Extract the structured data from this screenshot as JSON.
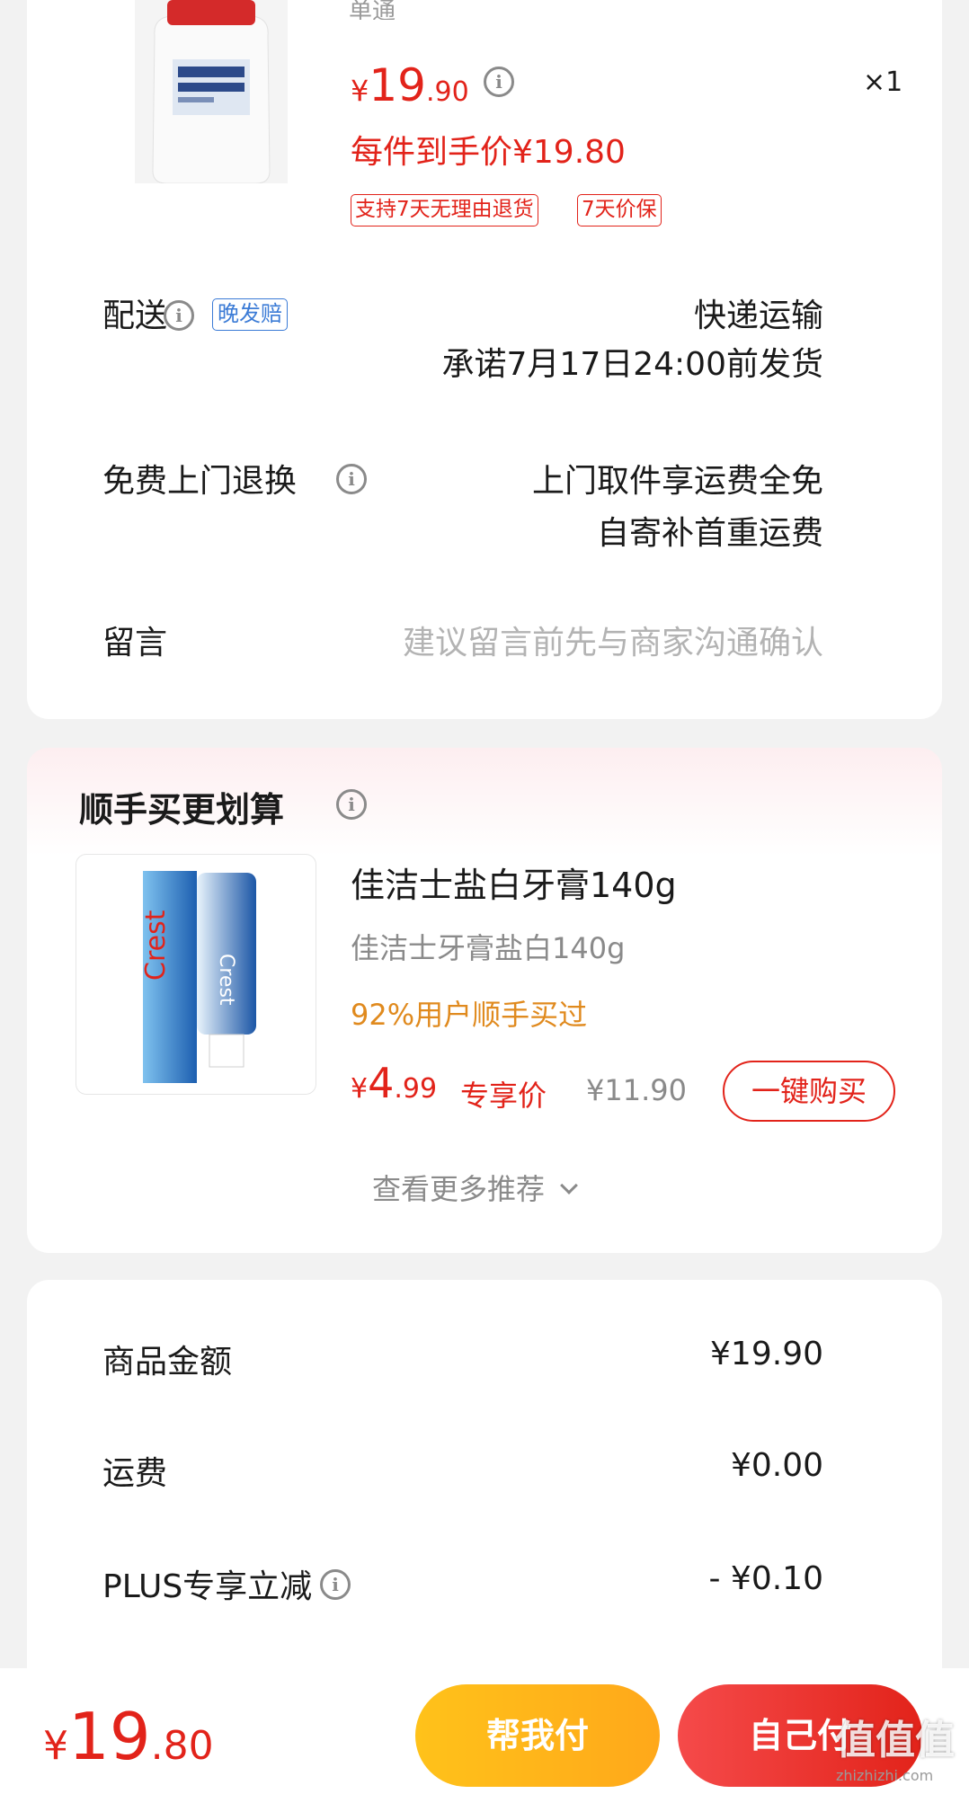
{
  "order": {
    "product_subtitle": "单通",
    "price_symbol": "¥",
    "price_int": "19",
    "price_dec": ".90",
    "quantity": "×1",
    "final_price": "每件到手价¥19.80",
    "tags": [
      "支持7天无理由退货",
      "7天价保"
    ]
  },
  "delivery": {
    "label": "配送",
    "badge": "晚发赔",
    "method": "快递运输",
    "promise": "承诺7月17日24:00前发货"
  },
  "return_service": {
    "label": "免费上门退换",
    "line1": "上门取件享运费全免",
    "line2": "自寄补首重运费"
  },
  "message": {
    "label": "留言",
    "placeholder": "建议留言前先与商家沟通确认"
  },
  "recommend": {
    "title": "顺手买更划算",
    "item_title": "佳洁士盐白牙膏140g",
    "item_spec": "佳洁士牙膏盐白140g",
    "item_social": "92%用户顺手买过",
    "price_symbol": "¥",
    "price_int": "4",
    "price_dec": ".99",
    "price_label": "专享价",
    "original_price": "¥11.90",
    "buy_label": "一键购买",
    "more_label": "查看更多推荐"
  },
  "summary": {
    "rows": [
      {
        "label": "商品金额",
        "value": "¥19.90"
      },
      {
        "label": "运费",
        "value": "¥0.00"
      },
      {
        "label": "PLUS专享立减",
        "value": "- ¥0.10"
      }
    ]
  },
  "bottom": {
    "price_symbol": "¥",
    "price_int": "19",
    "price_dec": ".80",
    "help_pay_label": "帮我付",
    "self_pay_label": "自己付"
  },
  "watermark": {
    "text": "值值值",
    "site": "zhizhizhi.com"
  },
  "colors": {
    "accent_red": "#e2231a",
    "accent_orange": "#e08a1e",
    "link_blue": "#3b7bd6"
  }
}
